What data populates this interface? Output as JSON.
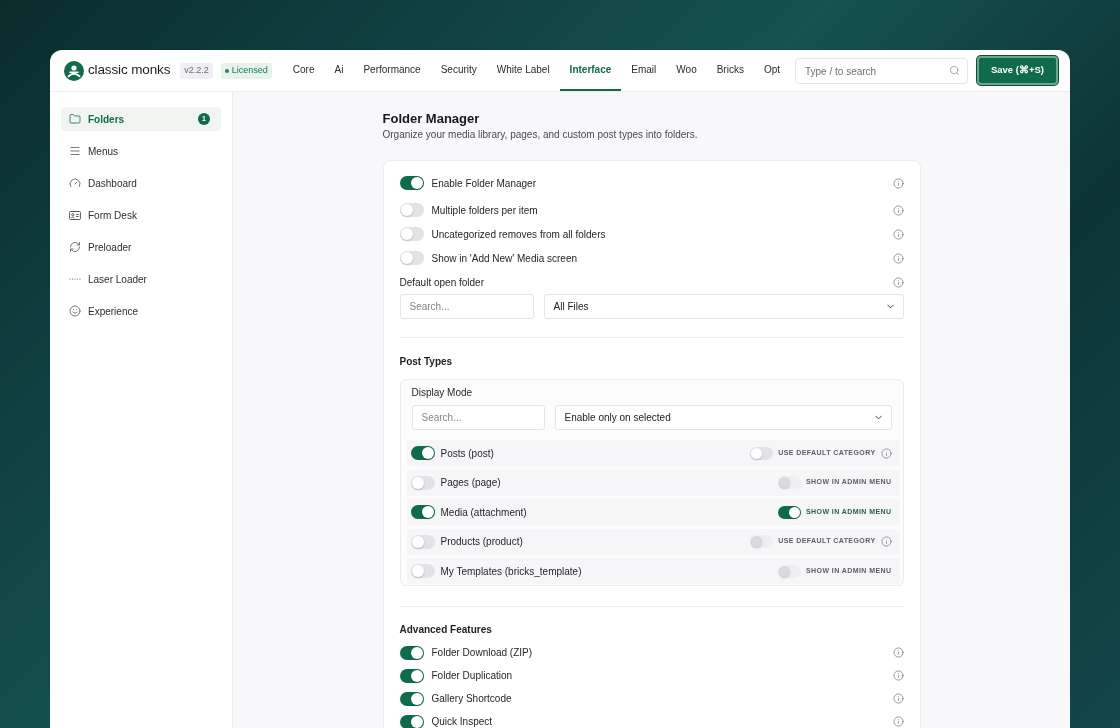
{
  "header": {
    "logo": "classic monks",
    "version": "v2.2.2",
    "license": "Licensed",
    "tabs": [
      {
        "label": "Core",
        "selected": false
      },
      {
        "label": "Ai",
        "selected": false
      },
      {
        "label": "Performance",
        "selected": false
      },
      {
        "label": "Security",
        "selected": false
      },
      {
        "label": "White Label",
        "selected": false
      },
      {
        "label": "Interface",
        "selected": true
      },
      {
        "label": "Email",
        "selected": false
      },
      {
        "label": "Woo",
        "selected": false
      },
      {
        "label": "Bricks",
        "selected": false
      },
      {
        "label": "Opt",
        "selected": false
      }
    ],
    "search": {
      "placeholder": "Type / to search"
    },
    "save_button": "Save (⌘+S)"
  },
  "sidebar": {
    "items": [
      {
        "label": "Folders",
        "selected": true,
        "badge": "1"
      },
      {
        "label": "Menus",
        "selected": false
      },
      {
        "label": "Dashboard",
        "selected": false
      },
      {
        "label": "Form Desk",
        "selected": false
      },
      {
        "label": "Preloader",
        "selected": false
      },
      {
        "label": "Laser Loader",
        "selected": false
      },
      {
        "label": "Experience",
        "selected": false
      }
    ]
  },
  "folder_manager": {
    "title": "Folder Manager",
    "subtitle": "Organize your media library, pages, and custom post types into folders.",
    "settings": [
      {
        "label": "Enable Folder Manager",
        "on": true
      },
      {
        "label": "Multiple folders per item",
        "on": false
      },
      {
        "label": "Uncategorized removes from all folders",
        "on": false
      },
      {
        "label": "Show in 'Add New' Media screen",
        "on": false
      }
    ],
    "default_open_folder": {
      "label": "Default open folder",
      "search": {
        "placeholder": "Search..."
      },
      "select": {
        "value": "All Files"
      }
    }
  },
  "post_types": {
    "title": "Post Types",
    "display_mode": {
      "label": "Display Mode",
      "search": {
        "placeholder": "Search..."
      },
      "select": {
        "value": "Enable only on selected"
      }
    },
    "rows": [
      {
        "label": "Posts (post)",
        "on": true,
        "option": {
          "label": "USE DEFAULT CATEGORY",
          "on": false,
          "disabled": false,
          "info": true
        }
      },
      {
        "label": "Pages (page)",
        "on": false,
        "option": {
          "label": "SHOW IN ADMIN MENU",
          "on": false,
          "disabled": true,
          "info": false
        }
      },
      {
        "label": "Media (attachment)",
        "on": true,
        "option": {
          "label": "SHOW IN ADMIN MENU",
          "on": true,
          "disabled": false,
          "info": false
        }
      },
      {
        "label": "Products (product)",
        "on": false,
        "option": {
          "label": "USE DEFAULT CATEGORY",
          "on": false,
          "disabled": true,
          "info": true
        }
      },
      {
        "label": "My Templates (bricks_template)",
        "on": false,
        "option": {
          "label": "SHOW IN ADMIN MENU",
          "on": false,
          "disabled": true,
          "info": false
        }
      }
    ]
  },
  "advanced_features": {
    "title": "Advanced Features",
    "settings": [
      {
        "label": "Folder Download (ZIP)",
        "on": true
      },
      {
        "label": "Folder Duplication",
        "on": true
      },
      {
        "label": "Gallery Shortcode",
        "on": true
      },
      {
        "label": "Quick Inspect",
        "on": true
      }
    ]
  }
}
